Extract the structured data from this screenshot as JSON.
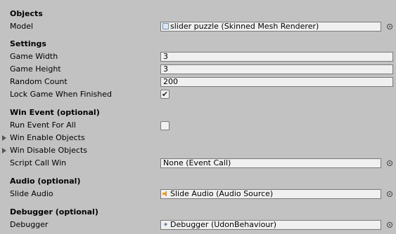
{
  "sections": {
    "objects": "Objects",
    "settings": "Settings",
    "win_event": "Win Event (optional)",
    "audio": "Audio (optional)",
    "debugger": "Debugger (optional)"
  },
  "fields": {
    "model": {
      "label": "Model",
      "value": "slider puzzle (Skinned Mesh Renderer)",
      "icon": "skinned-mesh-icon"
    },
    "game_width": {
      "label": "Game Width",
      "value": "3"
    },
    "game_height": {
      "label": "Game Height",
      "value": "3"
    },
    "random_count": {
      "label": "Random Count",
      "value": "200"
    },
    "lock_game": {
      "label": "Lock Game When Finished",
      "checked": true
    },
    "run_event_for_all": {
      "label": "Run Event For All",
      "checked": false
    },
    "win_enable_objects": {
      "label": "Win Enable Objects"
    },
    "win_disable_objects": {
      "label": "Win Disable Objects"
    },
    "script_call_win": {
      "label": "Script Call Win",
      "value": "None (Event Call)"
    },
    "slide_audio": {
      "label": "Slide Audio",
      "value": "Slide Audio (Audio Source)",
      "icon": "audio-source-icon"
    },
    "debugger": {
      "label": "Debugger",
      "value": "Debugger (UdonBehaviour)",
      "icon": "udon-behaviour-icon"
    }
  },
  "colors": {
    "background": "#c2c2c2",
    "field_background": "#f0f0f0",
    "field_border": "#7a7a7a",
    "audio_icon": "#e89a2c"
  }
}
